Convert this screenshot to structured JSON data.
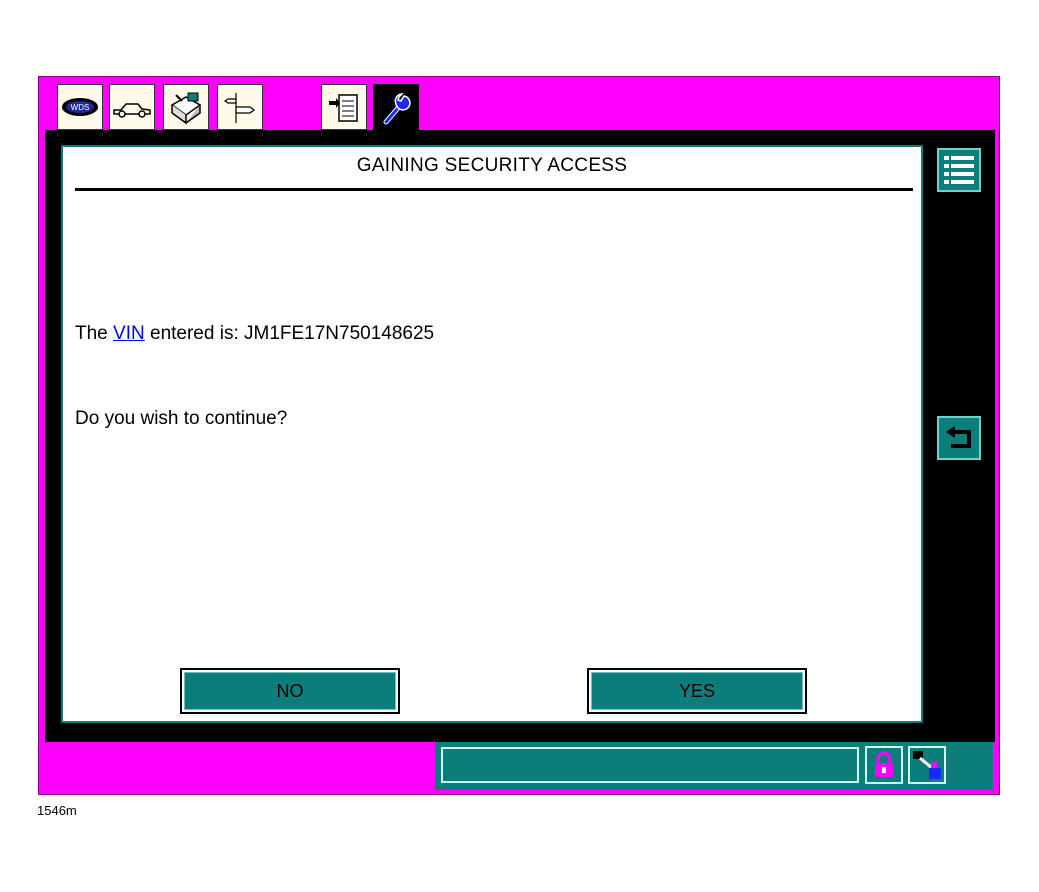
{
  "dialog": {
    "title": "GAINING SECURITY ACCESS",
    "vin_prefix": "The ",
    "vin_link": "VIN",
    "vin_suffix": " entered is: JM1FE17N750148625",
    "question": "Do you wish to continue?",
    "no_label": "NO",
    "yes_label": "YES"
  },
  "tabs": [
    {
      "icon": "wds-logo-icon"
    },
    {
      "icon": "vehicle-icon"
    },
    {
      "icon": "toolbox-icon"
    },
    {
      "icon": "signpost-icon"
    },
    {
      "icon": "document-icon"
    },
    {
      "icon": "wrench-icon"
    }
  ],
  "colors": {
    "frame": "#ff00ff",
    "accent": "#0b7d7b",
    "link": "#0000ee"
  },
  "figure_label": "1546m"
}
